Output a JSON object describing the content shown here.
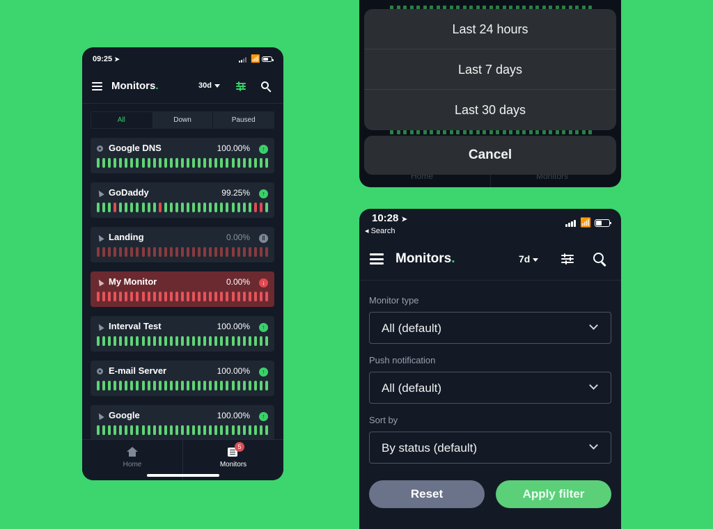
{
  "phone1": {
    "status_time": "09:25",
    "app_title": "Monitors",
    "app_title_dot": ".",
    "period": "30d",
    "segments": [
      "All",
      "Down",
      "Paused"
    ],
    "monitors": [
      {
        "name": "Google DNS",
        "uptime": "100.00%",
        "status": "up",
        "type": "ping",
        "status_icon": "↑"
      },
      {
        "name": "GoDaddy",
        "uptime": "99.25%",
        "status": "up",
        "type": "http",
        "status_icon": "↑"
      },
      {
        "name": "Landing",
        "uptime": "0.00%",
        "status": "paused",
        "type": "http",
        "status_icon": "‖"
      },
      {
        "name": "My Monitor",
        "uptime": "0.00%",
        "status": "down",
        "type": "http",
        "status_icon": "↓"
      },
      {
        "name": "Interval Test",
        "uptime": "100.00%",
        "status": "up",
        "type": "http",
        "status_icon": "↑"
      },
      {
        "name": "E-mail Server",
        "uptime": "100.00%",
        "status": "up",
        "type": "ping",
        "status_icon": "↑"
      },
      {
        "name": "Google",
        "uptime": "100.00%",
        "status": "up",
        "type": "http",
        "status_icon": "↑"
      }
    ],
    "tabs": {
      "home": "Home",
      "monitors": "Monitors",
      "monitors_badge": "5"
    }
  },
  "phone2": {
    "options": [
      "Last 24 hours",
      "Last 7 days",
      "Last 30 days"
    ],
    "cancel": "Cancel",
    "bg_tabs": [
      "Home",
      "Monitors"
    ]
  },
  "phone3": {
    "status_time": "10:28",
    "back_label": "◂ Search",
    "app_title": "Monitors",
    "app_title_dot": ".",
    "period": "7d",
    "monitor_type_label": "Monitor type",
    "monitor_type_value": "All (default)",
    "push_label": "Push notification",
    "push_value": "All (default)",
    "sort_label": "Sort by",
    "sort_value": "By status (default)",
    "reset": "Reset",
    "apply": "Apply filter"
  },
  "colors": {
    "background": "#3dd56d",
    "accent": "#3bd06a",
    "down": "#e04a52",
    "panel": "#131a26"
  }
}
